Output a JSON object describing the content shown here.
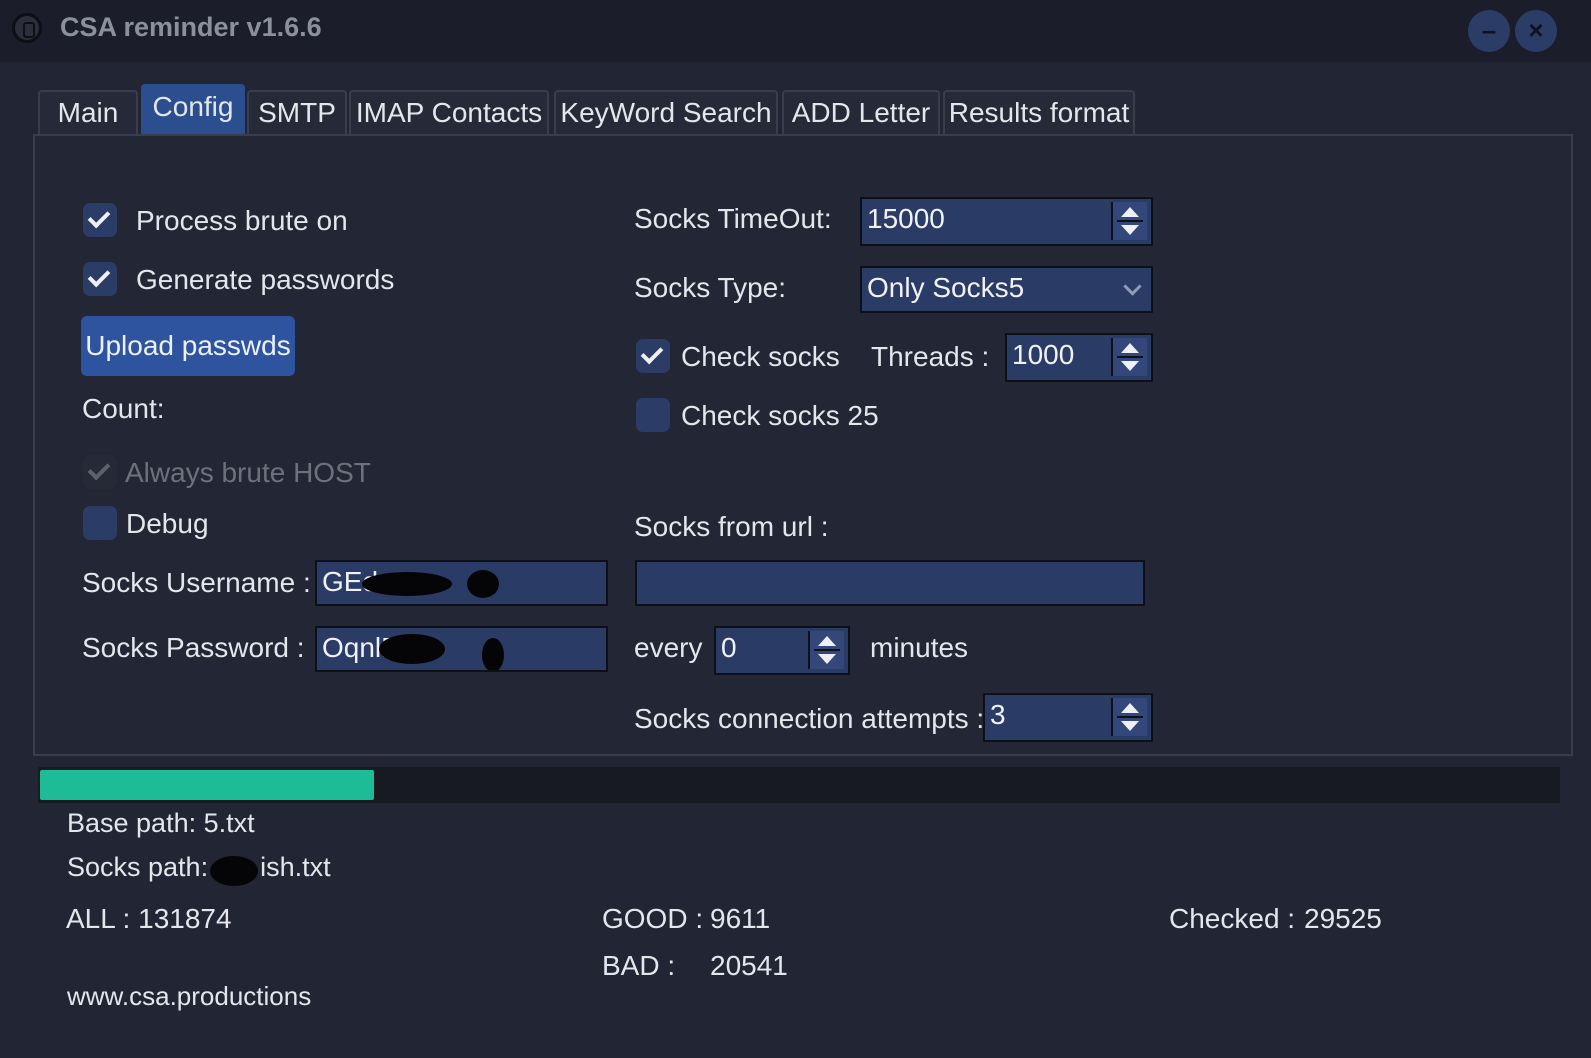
{
  "window": {
    "title": "CSA reminder v1.6.6",
    "minimize_glyph": "–",
    "close_glyph": "×"
  },
  "tabs": [
    {
      "label": "Main"
    },
    {
      "label": "Config"
    },
    {
      "label": "SMTP"
    },
    {
      "label": "IMAP Contacts"
    },
    {
      "label": "KeyWord Search"
    },
    {
      "label": "ADD Letter"
    },
    {
      "label": "Results format"
    }
  ],
  "config": {
    "process_brute_on": {
      "label": "Process brute on",
      "checked": true
    },
    "generate_passwords": {
      "label": "Generate passwords",
      "checked": true
    },
    "upload_button": "Upload passwds",
    "count_label": "Count:",
    "always_brute_host": {
      "label": "Always brute HOST",
      "checked": true,
      "disabled": true
    },
    "debug": {
      "label": "Debug",
      "checked": false
    },
    "socks_username": {
      "label": "Socks Username :",
      "value": "GEd"
    },
    "socks_password": {
      "label": "Socks Password :",
      "value": "OqnlF"
    },
    "socks_timeout": {
      "label": "Socks TimeOut:",
      "value": "15000"
    },
    "socks_type": {
      "label": "Socks Type:",
      "value": "Only Socks5"
    },
    "check_socks": {
      "label": "Check socks",
      "checked": true
    },
    "threads": {
      "label": "Threads :",
      "value": "1000"
    },
    "check_socks_25": {
      "label": "Check socks 25",
      "checked": false
    },
    "socks_from_url": {
      "label": "Socks from url :",
      "value": ""
    },
    "every": {
      "label": "every",
      "value": "0",
      "unit": "minutes"
    },
    "connection_attempts": {
      "label": "Socks connection attempts :",
      "value": "3"
    }
  },
  "progress": {
    "fraction": 0.22,
    "color": "#1dbc97"
  },
  "status": {
    "base_path": "Base path: 5.txt",
    "socks_path_prefix": "Socks path:",
    "socks_path_suffix": "ish.txt",
    "all_label": "ALL : 131874",
    "good_label": "GOOD :",
    "good_value": "9611",
    "bad_label": "BAD :",
    "bad_value": "20541",
    "checked_label": "Checked :",
    "checked_value": "29525",
    "website": "www.csa.productions"
  },
  "colors": {
    "background": "#222533",
    "accent": "#2e54a0",
    "field": "#2a3b65"
  }
}
